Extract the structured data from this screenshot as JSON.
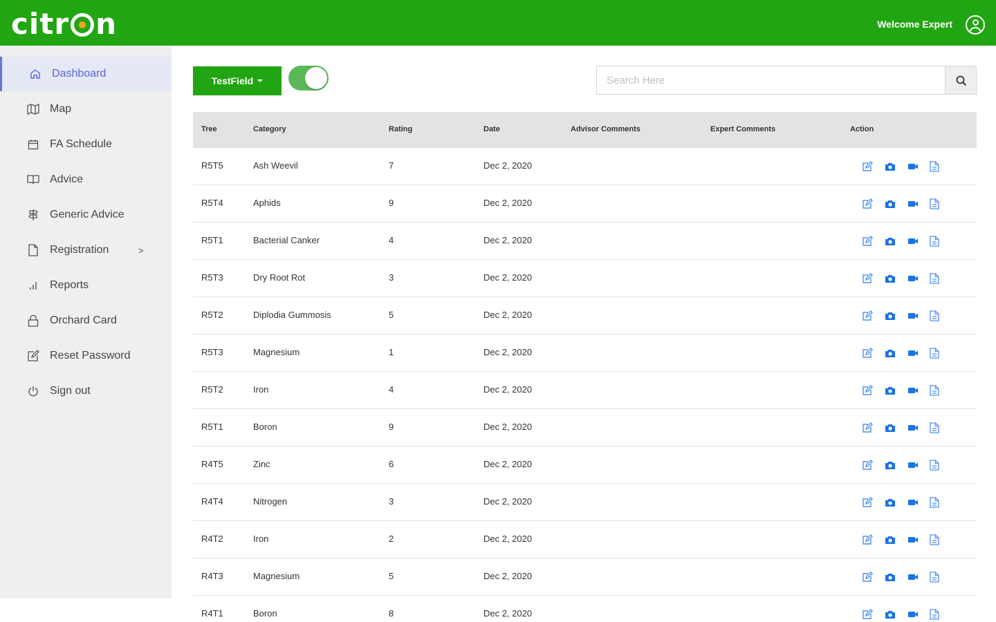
{
  "header": {
    "logo_text_left": "citr",
    "logo_text_right": "n",
    "welcome": "Welcome Expert",
    "user_icon": "user-circle-icon",
    "brand_color": "#22a512"
  },
  "sidebar": {
    "items": [
      {
        "label": "Dashboard",
        "icon": "home-icon",
        "active": true
      },
      {
        "label": "Map",
        "icon": "map-icon"
      },
      {
        "label": "FA Schedule",
        "icon": "calendar-icon"
      },
      {
        "label": "Advice",
        "icon": "book-icon"
      },
      {
        "label": "Generic Advice",
        "icon": "signpost-icon"
      },
      {
        "label": "Registration",
        "icon": "document-icon",
        "chevron": ">"
      },
      {
        "label": "Reports",
        "icon": "bar-chart-icon"
      },
      {
        "label": "Orchard Card",
        "icon": "lock-icon"
      },
      {
        "label": "Reset Password",
        "icon": "edit-icon"
      },
      {
        "label": "Sign out",
        "icon": "power-icon"
      }
    ]
  },
  "toolbar": {
    "field_button": "TestField",
    "toggle_on": true,
    "search_placeholder": "Search Here",
    "search_icon": "search-icon"
  },
  "table": {
    "headers": [
      "Tree",
      "Category",
      "Rating",
      "Date",
      "Advisor Comments",
      "Expert Comments",
      "Action"
    ],
    "action_icons": [
      "edit-icon",
      "camera-icon",
      "video-icon",
      "file-icon"
    ],
    "action_color": "#1a73e8",
    "rows": [
      {
        "tree": "R5T5",
        "category": "Ash Weevil",
        "rating": "7",
        "date": "Dec 2, 2020"
      },
      {
        "tree": "R5T4",
        "category": "Aphids",
        "rating": "9",
        "date": "Dec 2, 2020"
      },
      {
        "tree": "R5T1",
        "category": "Bacterial Canker",
        "rating": "4",
        "date": "Dec 2, 2020"
      },
      {
        "tree": "R5T3",
        "category": "Dry Root Rot",
        "rating": "3",
        "date": "Dec 2, 2020"
      },
      {
        "tree": "R5T2",
        "category": "Diplodia Gummosis",
        "rating": "5",
        "date": "Dec 2, 2020"
      },
      {
        "tree": "R5T3",
        "category": "Magnesium",
        "rating": "1",
        "date": "Dec 2, 2020"
      },
      {
        "tree": "R5T2",
        "category": "Iron",
        "rating": "4",
        "date": "Dec 2, 2020"
      },
      {
        "tree": "R5T1",
        "category": "Boron",
        "rating": "9",
        "date": "Dec 2, 2020"
      },
      {
        "tree": "R4T5",
        "category": "Zinc",
        "rating": "6",
        "date": "Dec 2, 2020"
      },
      {
        "tree": "R4T4",
        "category": "Nitrogen",
        "rating": "3",
        "date": "Dec 2, 2020"
      },
      {
        "tree": "R4T2",
        "category": "Iron",
        "rating": "2",
        "date": "Dec 2, 2020"
      },
      {
        "tree": "R4T3",
        "category": "Magnesium",
        "rating": "5",
        "date": "Dec 2, 2020"
      },
      {
        "tree": "R4T1",
        "category": "Boron",
        "rating": "8",
        "date": "Dec 2, 2020"
      }
    ]
  }
}
